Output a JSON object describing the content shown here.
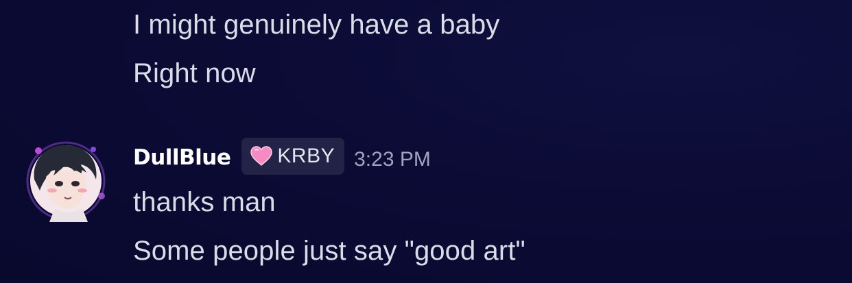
{
  "messages": {
    "previous": [
      "I might genuinely have a baby",
      "Right now"
    ],
    "current": {
      "username": "DullBlue",
      "tag": {
        "icon": "pink-heart-icon",
        "label": "KRBY"
      },
      "timestamp": "3:23 PM",
      "lines": [
        "thanks man",
        "Some people just say \"good art\""
      ]
    }
  },
  "colors": {
    "background": "#0b0b35",
    "message_text": "#dcdce8",
    "username": "#ffffff",
    "timestamp": "#a3a3bd",
    "tag_background": "#232347",
    "heart": "#f58bc2"
  }
}
